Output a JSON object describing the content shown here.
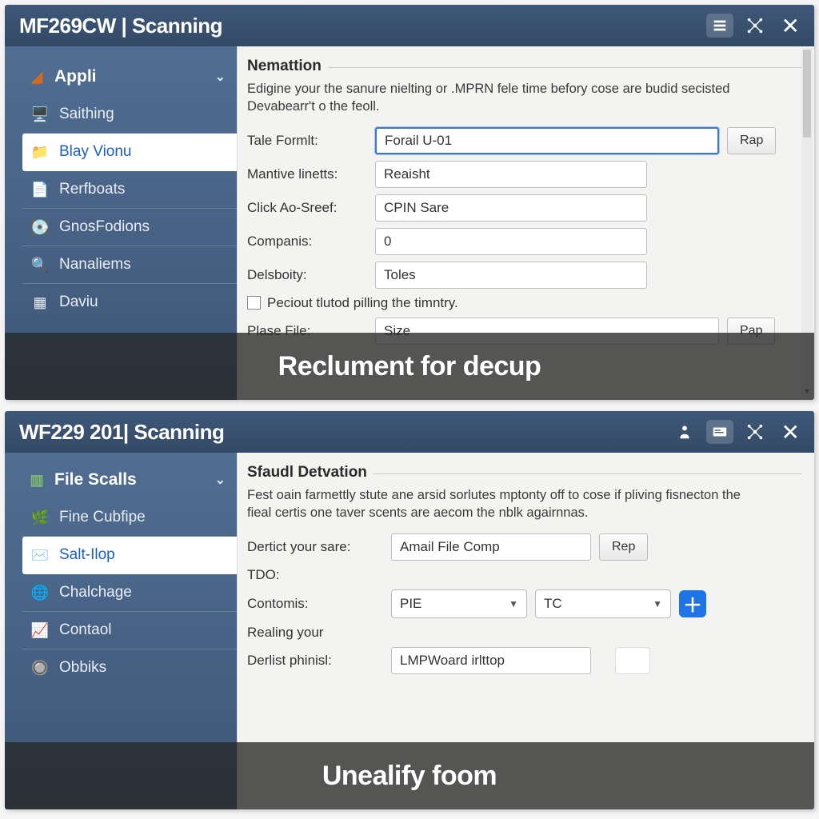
{
  "top": {
    "title": "MF269CW | Scanning",
    "sidebar": {
      "header": "Appli",
      "items": [
        {
          "label": "Saithing"
        },
        {
          "label": "Blay Vionu"
        },
        {
          "label": "Rerfboats"
        },
        {
          "label": "GnosFodions"
        },
        {
          "label": "Nanaliems"
        },
        {
          "label": "Daviu"
        }
      ]
    },
    "content": {
      "section_title": "Nemattion",
      "section_desc": "Edigine your the sanure nielting or .MPRN fele time befory cose are budid secisted Devabearr't o the feoll.",
      "rows": {
        "tale_formlt_label": "Tale Formlt:",
        "tale_formlt_value": "Forail U-01",
        "rap_label": "Rap",
        "mantive_label": "Mantive linetts:",
        "mantive_value": "Reaisht",
        "click_label": "Click Ao-Sreef:",
        "click_value": "CPIN Sare",
        "companis_label": "Companis:",
        "companis_value": "0",
        "delsboity_label": "Delsboity:",
        "delsboity_value": "Toles",
        "checkbox_label": "Peciout tlutod pilling the timntry.",
        "plase_label": "Plase File:",
        "plase_value": "Size",
        "pap_label": "Pap"
      }
    },
    "overlay": "Reclument for decup"
  },
  "bottom": {
    "title": "WF229 201| Scanning",
    "sidebar": {
      "header": "File Scalls",
      "items": [
        {
          "label": "Fine Cubfipe"
        },
        {
          "label": "Salt-Ilop"
        },
        {
          "label": "Chalchage"
        },
        {
          "label": "Contaol"
        },
        {
          "label": "Obbiks"
        }
      ]
    },
    "content": {
      "section_title": "Sfaudl Detvation",
      "section_desc": "Fest oain farmettly stute ane arsid sorlutes mptonty off to cose if pliving fisnecton the fieal certis one taver scents are aecom the nblk agairnnas.",
      "rows": {
        "dertict_label": "Dertict your sare:",
        "dertict_value": "Amail File Comp",
        "rep_label": "Rep",
        "tdo_label": "TDO:",
        "contomis_label": "Contomis:",
        "select1_value": "PIE",
        "select2_value": "TC",
        "realing_label": "Realing your",
        "derlist_label": "Derlist phinisl:",
        "derlist_value": "LMPWoard irlttop"
      }
    },
    "overlay": "Unealify foom"
  }
}
